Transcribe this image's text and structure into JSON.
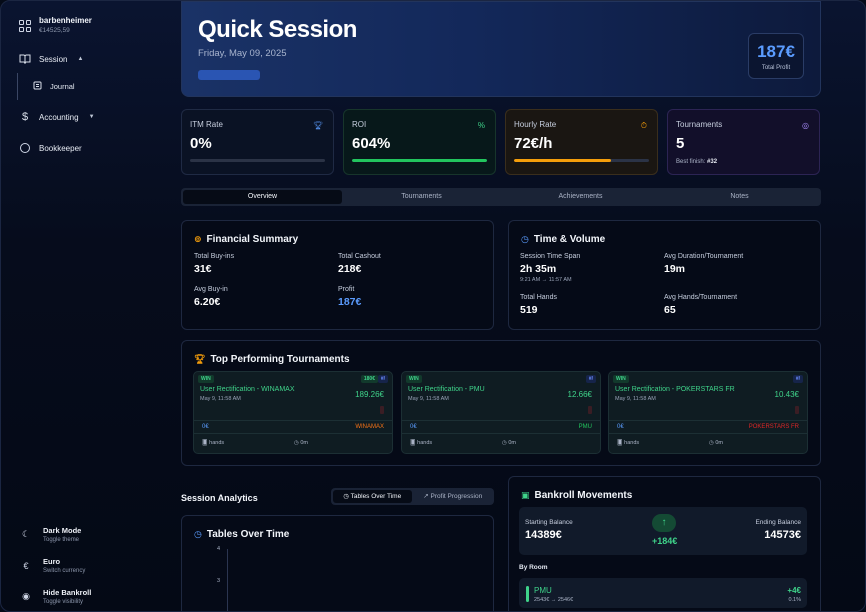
{
  "user": {
    "name": "barbenheimer",
    "balance": "€14525,59"
  },
  "nav": {
    "session": "Session",
    "journal": "Journal",
    "accounting": "Accounting",
    "bookkeeper": "Bookkeeper"
  },
  "settings": [
    {
      "title": "Dark Mode",
      "subtitle": "Toggle theme",
      "icon": "moon-icon"
    },
    {
      "title": "Euro",
      "subtitle": "Switch currency",
      "icon": "euro-icon"
    },
    {
      "title": "Hide Bankroll",
      "subtitle": "Toggle visibility",
      "icon": "eye-icon"
    }
  ],
  "hero": {
    "title": "Quick Session",
    "date": "Friday, May 09, 2025",
    "profit_value": "187€",
    "profit_label": "Total Profit"
  },
  "stats": {
    "itm": {
      "label": "ITM Rate",
      "value": "0%",
      "progress": 0,
      "color": "#3b82f6"
    },
    "roi": {
      "label": "ROI",
      "value": "604%",
      "progress": 1.0,
      "color": "#22c55e"
    },
    "hourly": {
      "label": "Hourly Rate",
      "value": "72€/h",
      "progress": 0.72,
      "color": "#f59e0b"
    },
    "tournaments": {
      "label": "Tournaments",
      "value": "5",
      "best_label": "Best finish:",
      "best_value": "#32"
    }
  },
  "tabs": [
    "Overview",
    "Tournaments",
    "Achievements",
    "Notes"
  ],
  "financial": {
    "title": "Financial Summary",
    "total_buyins_label": "Total Buy-ins",
    "total_buyins": "31€",
    "total_cashout_label": "Total Cashout",
    "total_cashout": "218€",
    "avg_buyin_label": "Avg Buy-in",
    "avg_buyin": "6.20€",
    "profit_label": "Profit",
    "profit": "187€"
  },
  "time_volume": {
    "title": "Time & Volume",
    "span_label": "Session Time Span",
    "span": "2h 35m",
    "span_range": "9:21 AM → 11:57 AM",
    "avg_duration_label": "Avg Duration/Tournament",
    "avg_duration": "19m",
    "total_hands_label": "Total Hands",
    "total_hands": "519",
    "avg_hands_label": "Avg Hands/Tournament",
    "avg_hands": "65"
  },
  "top_tournaments": {
    "title": "Top Performing Tournaments",
    "items": [
      {
        "badge": "WIN",
        "pct": "180€",
        "rank": "#/",
        "name": "User Rectification - WINAMAX",
        "date": "May 9, 11:58 AM",
        "amount": "189.26€",
        "buyin": "0€",
        "room": "WINAMAX",
        "room_color": "#f97316",
        "hands": "hands",
        "time": "0m"
      },
      {
        "badge": "WIN",
        "pct": "",
        "rank": "#/",
        "name": "User Rectification - PMU",
        "date": "May 9, 11:58 AM",
        "amount": "12.66€",
        "buyin": "0€",
        "room": "PMU",
        "room_color": "#22c55e",
        "hands": "hands",
        "time": "0m"
      },
      {
        "badge": "WIN",
        "pct": "",
        "rank": "#/",
        "name": "User Rectification - POKERSTARS FR",
        "date": "May 9, 11:58 AM",
        "amount": "10.43€",
        "buyin": "0€",
        "room": "POKERSTARS FR",
        "room_color": "#dc2626",
        "hands": "hands",
        "time": "0m"
      }
    ]
  },
  "analytics": {
    "title": "Session Analytics",
    "seg_tables": "Tables Over Time",
    "seg_progression": "Profit Progression",
    "chart_title": "Tables Over Time"
  },
  "chart_data": {
    "type": "line",
    "title": "Tables Over Time",
    "y_ticks": [
      "4",
      "3"
    ],
    "series": []
  },
  "bankroll": {
    "title": "Bankroll Movements",
    "starting_label": "Starting Balance",
    "starting": "14389€",
    "ending_label": "Ending Balance",
    "ending": "14573€",
    "delta": "+184€",
    "by_room_label": "By Room",
    "rooms": [
      {
        "name": "PMU",
        "range": "2543€ → 2546€",
        "delta": "+4€",
        "pct": "0.1%"
      }
    ]
  }
}
